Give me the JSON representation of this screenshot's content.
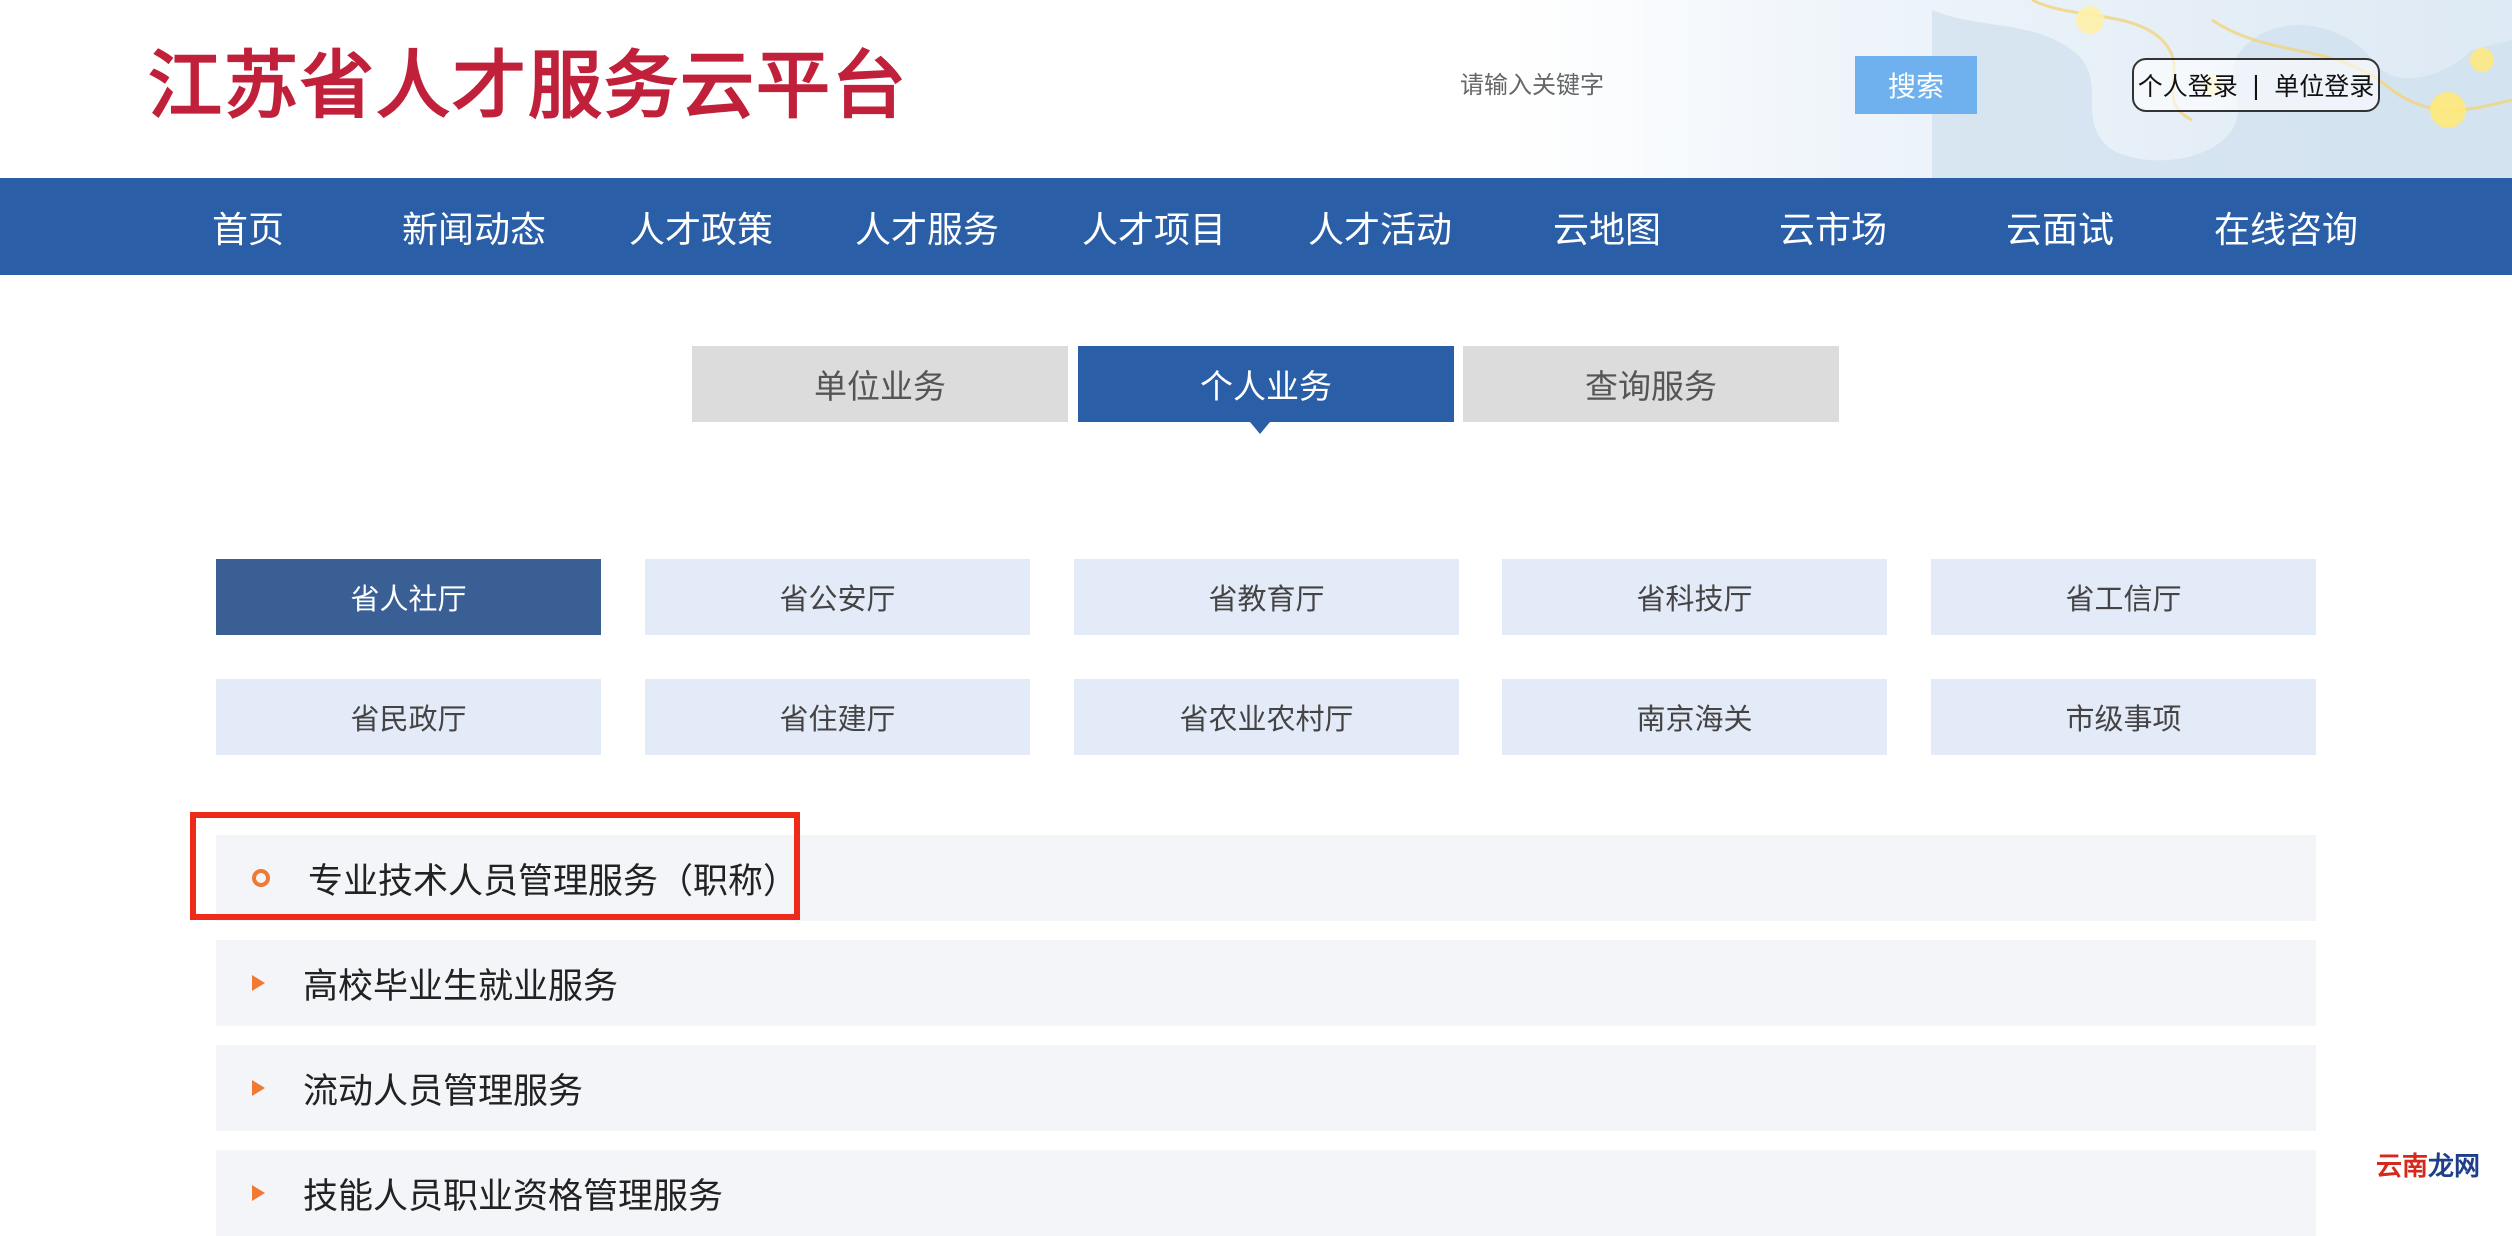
{
  "header": {
    "title": "江苏省人才服务云平台",
    "search": {
      "placeholder": "请输入关键字",
      "value": "",
      "button_label": "搜索"
    },
    "login": {
      "personal": "个人登录",
      "separator": "|",
      "unit": "单位登录"
    }
  },
  "nav": {
    "items": [
      "首页",
      "新闻动态",
      "人才政策",
      "人才服务",
      "人才项目",
      "人才活动",
      "云地图",
      "云市场",
      "云面试",
      "在线咨询"
    ]
  },
  "tabs": {
    "items": [
      "单位业务",
      "个人业务",
      "查询服务"
    ],
    "active": "个人业务"
  },
  "departments": {
    "items": [
      "省人社厅",
      "省公安厅",
      "省教育厅",
      "省科技厅",
      "省工信厅",
      "省民政厅",
      "省住建厅",
      "省农业农村厅",
      "南京海关",
      "市级事项"
    ],
    "active": "省人社厅"
  },
  "services": {
    "items": [
      "专业技术人员管理服务（职称）",
      "高校毕业生就业服务",
      "流动人员管理服务",
      "技能人员职业资格管理服务"
    ],
    "selected": "专业技术人员管理服务（职称）"
  },
  "watermark": {
    "part_a": "云南",
    "part_b": "龙网"
  },
  "colors": {
    "title_red": "#c0203a",
    "nav_blue": "#2a5ea6",
    "search_button": "#6fb1ef",
    "dept_active": "#3a5f95",
    "dept_bg": "#e4ebf8",
    "bullet_orange": "#ee7a35",
    "highlight_red": "#ee2a1a"
  }
}
